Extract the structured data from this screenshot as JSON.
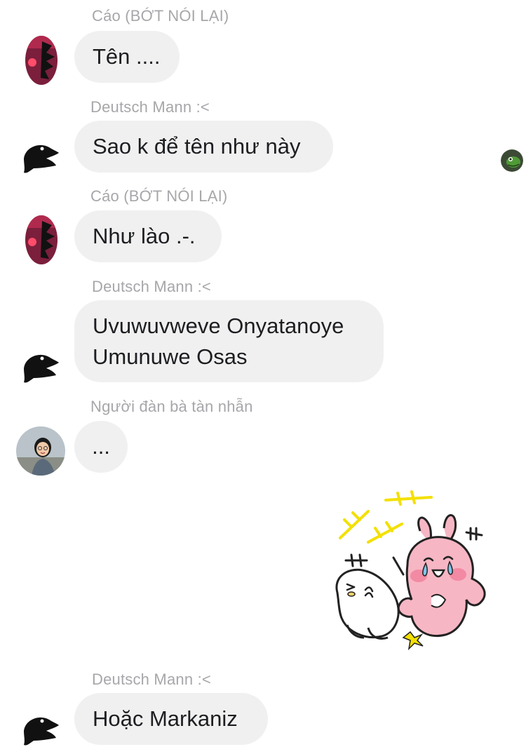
{
  "messages": [
    {
      "sender": "Cáo (BỚT NÓI LẠI)",
      "text": "Tên ...."
    },
    {
      "sender": "Deutsch Mann :<",
      "text": "Sao k để tên như này"
    },
    {
      "sender": "Cáo (BỚT NÓI LẠI)",
      "text": "Như lào .-."
    },
    {
      "sender": "Deutsch Mann :<",
      "lines": [
        "Uvuwuvweve Onyatanoye",
        "Umunuwe Osas"
      ]
    },
    {
      "sender": "Người đàn bà tàn nhẫn",
      "text": "..."
    },
    {
      "sender": "Deutsch Mann :<",
      "text": "Hoặc Markaniz"
    }
  ],
  "icons": {
    "fox_avatar": "fox-avatar",
    "bird_avatar": "black-bird-avatar",
    "girl_avatar": "girl-photo-avatar",
    "dino_avatar": "dinosaur-read-receipt-avatar",
    "sticker": "crying-rabbit-sticker"
  },
  "colors": {
    "bubble_bg": "#f1f0f0",
    "sender_text": "#a7a7ab",
    "message_text": "#1c1e21",
    "sticker_pink": "#f7b6c4",
    "sticker_yellow": "#f3e000"
  }
}
